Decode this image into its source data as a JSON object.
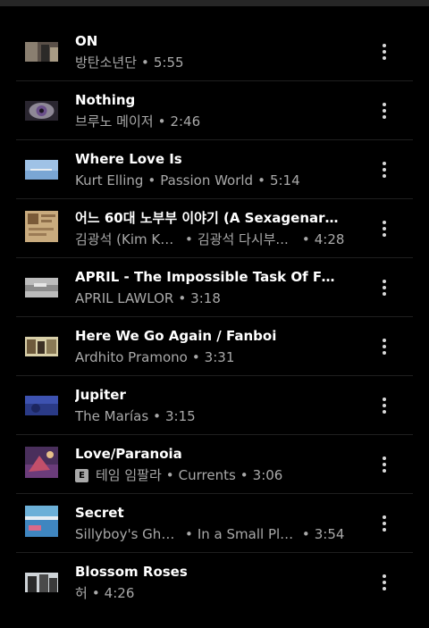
{
  "tracks": [
    {
      "title": "ON",
      "subtitle_parts": [
        "방탄소년단",
        "5:55"
      ],
      "explicit": false
    },
    {
      "title": "Nothing",
      "subtitle_parts": [
        "브루노 메이저",
        "2:46"
      ],
      "explicit": false
    },
    {
      "title": "Where Love Is",
      "subtitle_parts": [
        "Kurt Elling",
        "Passion World",
        "5:14"
      ],
      "explicit": false
    },
    {
      "title": "어느 60대 노부부 이야기 (A Sexagenary C...",
      "subtitle_parts": [
        "김광석 (Kim Kw...",
        "김광석 다시부...",
        "4:28"
      ],
      "explicit": false
    },
    {
      "title": "APRIL - The Impossible Task Of Feelin...",
      "subtitle_parts": [
        "APRIL LAWLOR",
        "3:18"
      ],
      "explicit": false
    },
    {
      "title": "Here We Go Again / Fanboi",
      "subtitle_parts": [
        "Ardhito Pramono",
        "3:31"
      ],
      "explicit": false
    },
    {
      "title": "Jupiter",
      "subtitle_parts": [
        "The Marías",
        "3:15"
      ],
      "explicit": false
    },
    {
      "title": "Love/Paranoia",
      "subtitle_parts": [
        "테임 임팔라",
        "Currents",
        "3:06"
      ],
      "explicit": true
    },
    {
      "title": "Secret",
      "subtitle_parts": [
        "Sillyboy's Ghos...",
        "In a Small Pla...",
        "3:54"
      ],
      "explicit": false
    },
    {
      "title": "Blossom Roses",
      "subtitle_parts": [
        "허",
        "4:26"
      ],
      "explicit": false
    }
  ],
  "explicit_badge": "E",
  "separator": "•",
  "icons": {
    "more": "more-vert-icon",
    "explicit": "explicit-badge"
  },
  "colors": {
    "background": "#000000",
    "title": "#ffffff",
    "subtitle": "#a9a9a9"
  }
}
